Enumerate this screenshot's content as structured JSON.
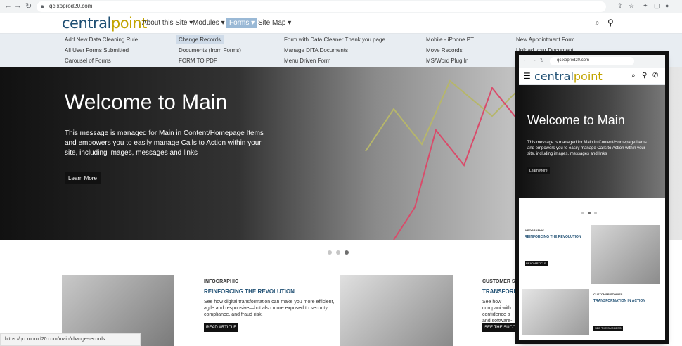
{
  "browser": {
    "url": "qc.xoprod20.com"
  },
  "site": {
    "logo": {
      "part1": "central",
      "part2": "point"
    },
    "menu": [
      {
        "label": "About this Site ▾"
      },
      {
        "label": "Modules ▾"
      },
      {
        "label": "Forms ▾"
      },
      {
        "label": "Site Map ▾"
      }
    ]
  },
  "dropdown": {
    "items": [
      "Add New Data Cleaning Rule",
      "All User Forms Submitted",
      "Carousel of Forms",
      "Change Records",
      "Documents (from Forms)",
      "FORM TO PDF",
      "Form with Data Cleaner Thank you page",
      "Manage DITA Documents",
      "Menu Driven Form",
      "Mobile - iPhone PT",
      "Move Records",
      "MS/Word Plug In",
      "New Appointment Form",
      "Upload your Document"
    ]
  },
  "hero": {
    "title": "Welcome to Main",
    "text": "This message is managed for Main in Content/Homepage Items and empowers you to easily manage Calls to Action within your site, including images, messages and links",
    "button": "Learn More"
  },
  "cards": [
    {
      "tag": "INFOGRAPHIC",
      "title": "REINFORCING THE REVOLUTION",
      "text": "See how digital transformation can make you more efficient, agile and responsive—but also more exposed to security, compliance, and fraud risk.",
      "button": "READ ARTICLE"
    },
    {
      "tag": "CUSTOMER STORIES",
      "title": "TRANSFORMATI",
      "text": "See how compani with confidence a and software-as-",
      "button": "SEE THE SUCCESS"
    }
  ],
  "status_url": "https://qc.xoprod20.com/main/change-records",
  "phone": {
    "url": "qc.xoprod20.com",
    "hero_title": "Welcome to Main",
    "hero_text": "This message is managed for Main in Content/Homepage Items and empowers you to easily manage Calls to Action within your site, including images, messages and links",
    "hero_button": "Learn More",
    "card1_tag": "INFOGRAPHIC",
    "card1_title": "REINFORCING THE REVOLUTION",
    "card1_button": "READ ARTICLE",
    "card2_tag": "CUSTOMER STORIES",
    "card2_title": "TRANSFORMATION IN ACTION",
    "card2_button": "SEE THE SUCCESS"
  }
}
